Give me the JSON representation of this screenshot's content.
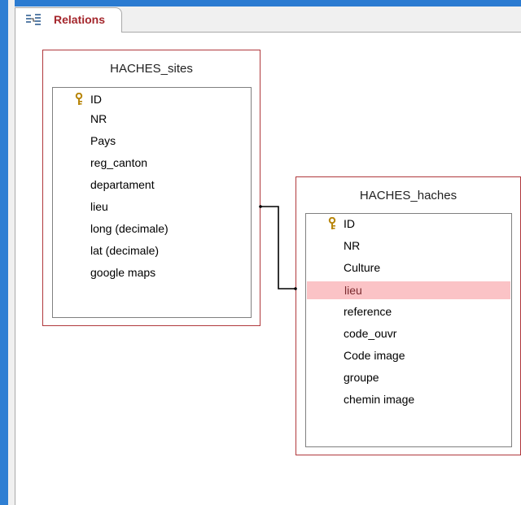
{
  "tab": {
    "label": "Relations",
    "icon": "relationships-icon"
  },
  "tables": {
    "sites": {
      "title": "HACHES_sites",
      "fields": [
        "ID",
        "NR",
        "Pays",
        "reg_canton",
        "departament",
        "lieu",
        "long (decimale)",
        "lat (decimale)",
        "google maps"
      ],
      "key_field": "ID"
    },
    "haches": {
      "title": "HACHES_haches",
      "fields": [
        "ID",
        "NR",
        "Culture",
        "lieu",
        "reference",
        "code_ouvr",
        "Code image",
        "groupe",
        "chemin image"
      ],
      "key_field": "ID",
      "selected_field": "lieu"
    }
  },
  "relationship": {
    "from": "HACHES_sites.lieu",
    "to": "HACHES_haches.lieu"
  },
  "colors": {
    "tab_label": "#a4262c",
    "table_border": "#b0383c",
    "selected_row": "#fbc3c6",
    "left_bar": "#2f7fd3"
  }
}
